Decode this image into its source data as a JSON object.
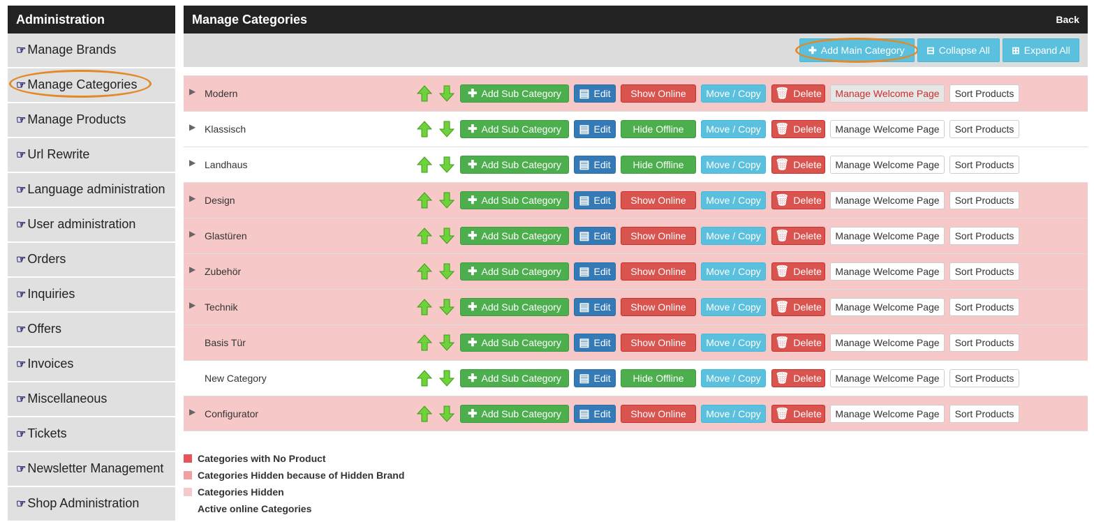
{
  "sidebar": {
    "title": "Administration",
    "items": [
      {
        "label": "Manage Brands"
      },
      {
        "label": "Manage Categories"
      },
      {
        "label": "Manage Products"
      },
      {
        "label": "Url Rewrite"
      },
      {
        "label": "Language administration"
      },
      {
        "label": "User administration"
      },
      {
        "label": "Orders"
      },
      {
        "label": "Inquiries"
      },
      {
        "label": "Offers"
      },
      {
        "label": "Invoices"
      },
      {
        "label": "Miscellaneous"
      },
      {
        "label": "Tickets"
      },
      {
        "label": "Newsletter Management"
      },
      {
        "label": "Shop Administration"
      }
    ]
  },
  "main": {
    "title": "Manage Categories",
    "back_label": "Back",
    "toolbar": {
      "add_main": "Add Main Category",
      "collapse_all": "Collapse All",
      "expand_all": "Expand All"
    },
    "buttons": {
      "add_sub": "Add Sub Category",
      "edit": "Edit",
      "show_online": "Show Online",
      "hide_offline": "Hide Offline",
      "move_copy": "Move / Copy",
      "delete": "Delete",
      "welcome": "Manage Welcome Page",
      "sort": "Sort Products"
    },
    "categories": [
      {
        "name": "Modern",
        "state": "Show Online"
      },
      {
        "name": "Klassisch",
        "state": "Hide Offline"
      },
      {
        "name": "Landhaus",
        "state": "Hide Offline"
      },
      {
        "name": "Design",
        "state": "Show Online"
      },
      {
        "name": "Glastüren",
        "state": "Show Online"
      },
      {
        "name": "Zubehör",
        "state": "Show Online"
      },
      {
        "name": "Technik",
        "state": "Show Online"
      },
      {
        "name": "Basis Tür",
        "state": "Show Online"
      },
      {
        "name": "New Category",
        "state": "Hide Offline"
      },
      {
        "name": "Configurator",
        "state": "Show Online"
      }
    ]
  },
  "legend": [
    {
      "label": "Categories with No Product",
      "color": "#e8545a"
    },
    {
      "label": "Categories Hidden because of Hidden Brand",
      "color": "#f2a09f"
    },
    {
      "label": "Categories Hidden",
      "color": "#f7c8c8"
    },
    {
      "label": "Active online Categories",
      "color": "#ffffff"
    }
  ],
  "colors": {
    "header_bg": "#222222",
    "highlight_oval": "#e08a2a",
    "row_pink": "#f7c8c8"
  }
}
